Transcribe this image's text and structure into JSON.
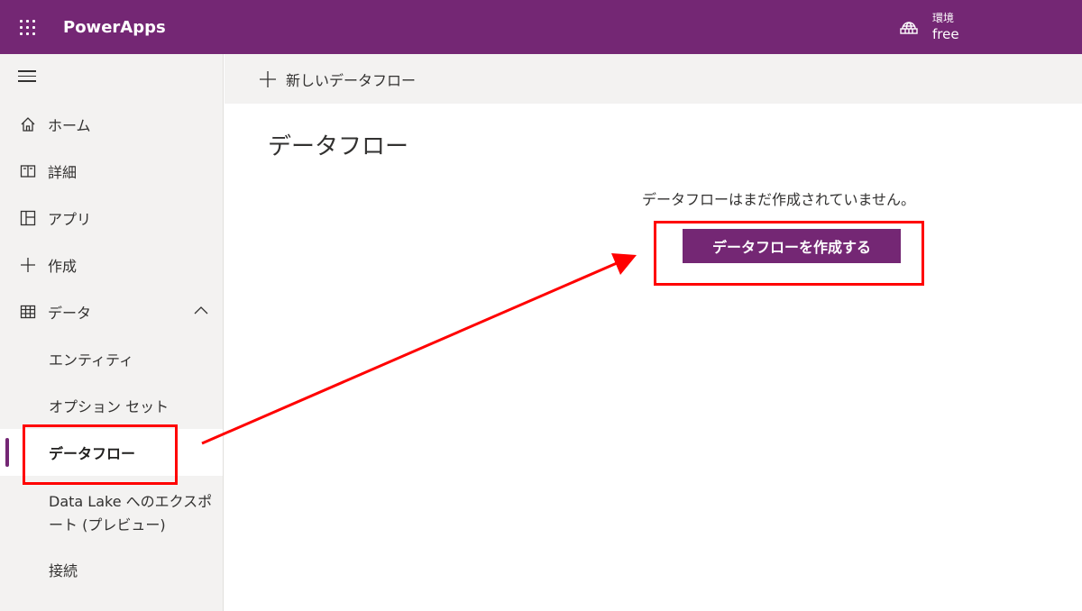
{
  "topbar": {
    "app_title": "PowerApps",
    "environment_label": "環境",
    "environment_name": "free"
  },
  "sidebar": {
    "items": [
      {
        "label": "ホーム",
        "icon": "home-icon"
      },
      {
        "label": "詳細",
        "icon": "book-icon"
      },
      {
        "label": "アプリ",
        "icon": "apps-icon"
      },
      {
        "label": "作成",
        "icon": "plus-icon"
      },
      {
        "label": "データ",
        "icon": "table-icon",
        "expanded": true
      }
    ],
    "data_subitems": [
      {
        "label": "エンティティ"
      },
      {
        "label": "オプション セット"
      },
      {
        "label": "データフロー",
        "active": true
      },
      {
        "label": "Data Lake へのエクスポート (プレビュー)"
      },
      {
        "label": "接続"
      }
    ]
  },
  "commandbar": {
    "new_dataflow_label": "新しいデータフロー"
  },
  "main": {
    "title": "データフロー",
    "empty_message": "データフローはまだ作成されていません。",
    "create_button_label": "データフローを作成する"
  },
  "colors": {
    "brand": "#742774",
    "sidebar_bg": "#f3f2f1",
    "annotation": "#ff0000"
  }
}
